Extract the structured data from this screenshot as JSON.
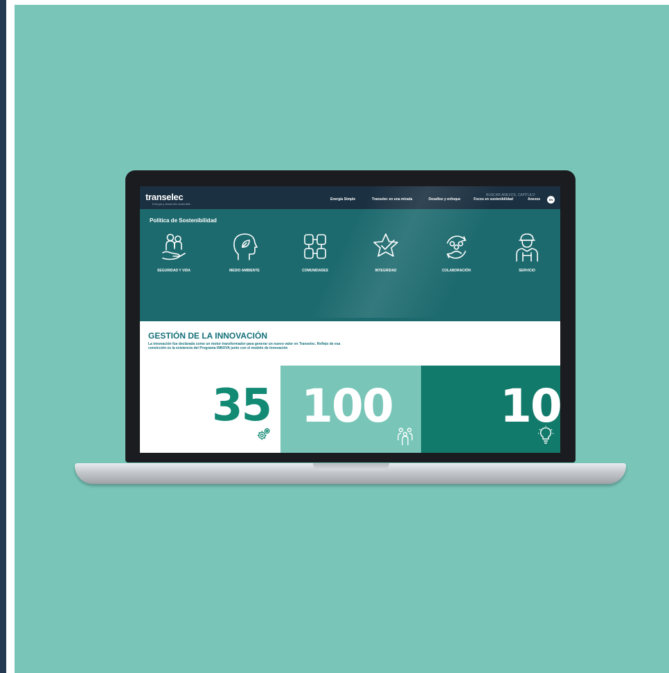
{
  "header": {
    "logo": "transelec",
    "logo_sub": "Energía y desarrollo sostenible",
    "nav": [
      "Energía Simple",
      "Transelec en una mirada",
      "Desafíos y enfoque",
      "Focos en sostenibilidad",
      "Anexos"
    ],
    "search_hint": "BUSCAR ANEXOS, CAPÍTULO",
    "lang": "EN"
  },
  "policy": {
    "title": "Política de Sostenibilidad",
    "values": [
      "SEGURIDAD Y VIDA",
      "MEDIO AMBIENTE",
      "COMUNIDADES",
      "INTEGRIDAD",
      "COLABORACIÓN",
      "SERVICIO"
    ],
    "icons": [
      "family-hand-icon",
      "head-leaf-icon",
      "joined-hands-icon",
      "star-check-icon",
      "team-cycle-icon",
      "worker-icon"
    ]
  },
  "innovation": {
    "title": "GESTIÓN DE LA INNOVACIÓN",
    "text": "La innovación fue declarada como un motor transformador para generar un nuevo valor en Transelec. Reflejo de esa convicción es la existencia del Programa INNOVA junto con el modelo de innovación"
  },
  "stats": [
    {
      "value": "35",
      "icon": "gears-icon",
      "bg": "#ffffff",
      "color": "#138a74"
    },
    {
      "value": "100",
      "icon": "people-icon",
      "bg": "#79c6b9",
      "color": "#ffffff"
    },
    {
      "value": "10",
      "icon": "lightbulb-icon",
      "bg": "#127a6b",
      "color": "#ffffff"
    }
  ],
  "colors": {
    "background": "#79c6b9",
    "nav": "#1b3041",
    "panel": "#1d6a6e",
    "accent": "#13707a"
  }
}
